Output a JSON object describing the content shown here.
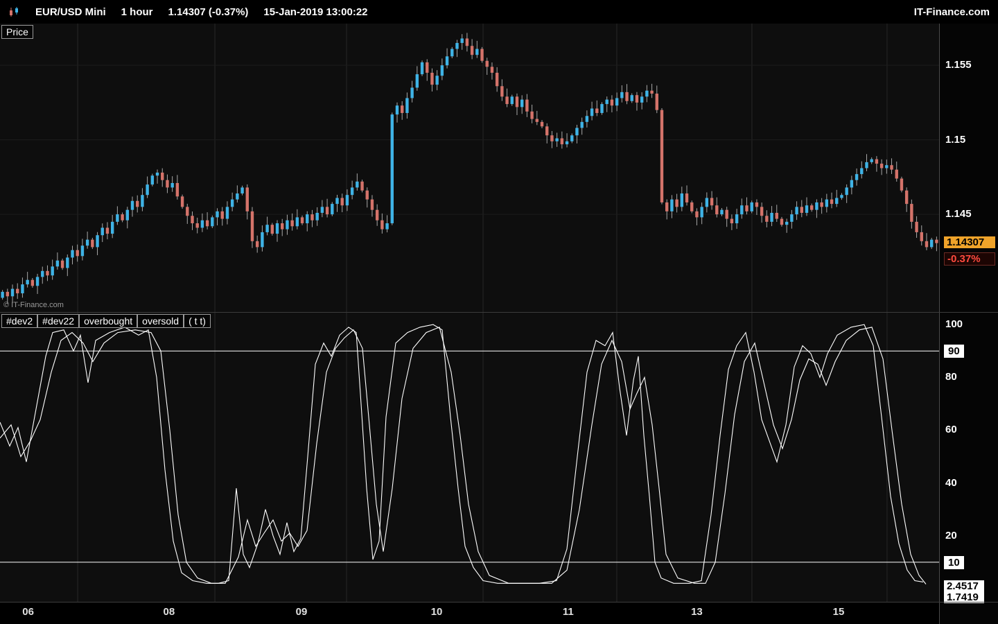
{
  "titlebar": {
    "symbol": "EUR/USD Mini",
    "timeframe": "1 hour",
    "quote": "1.14307 (-0.37%)",
    "datetime": "15-Jan-2019 13:00:22",
    "brand": "IT-Finance.com"
  },
  "watermark": "© IT-Finance.com",
  "badges": {
    "last_price": "1.14307",
    "change": "-0.37%"
  },
  "chart_data": {
    "type": "candlestick",
    "title": "EUR/USD Mini 1 hour",
    "last_price": 1.14307,
    "change_pct": -0.37,
    "colors": {
      "up": "#3fb3e6",
      "down": "#d4736a",
      "wick": "#a9a9a9",
      "line": "#ffffff",
      "grid": "#282828",
      "grid_h": "#1c1c1c",
      "badge_bg": "#f0a32a",
      "neg": "#ff4a3e"
    },
    "price_panel": {
      "label": "Price",
      "ylim": [
        1.1384,
        1.1578
      ],
      "yticks": [
        1.155,
        1.15,
        1.145
      ],
      "wick": 0.0005,
      "closes": [
        1.1398,
        1.1395,
        1.14,
        1.1397,
        1.1403,
        1.1406,
        1.1402,
        1.1408,
        1.1412,
        1.1409,
        1.1415,
        1.1419,
        1.1414,
        1.1421,
        1.1426,
        1.1422,
        1.1429,
        1.1433,
        1.1428,
        1.1436,
        1.1441,
        1.1437,
        1.1445,
        1.145,
        1.1446,
        1.1453,
        1.1459,
        1.1455,
        1.1463,
        1.147,
        1.1476,
        1.1478,
        1.1473,
        1.1468,
        1.1471,
        1.1462,
        1.1455,
        1.1449,
        1.1444,
        1.1441,
        1.1446,
        1.1442,
        1.1448,
        1.1452,
        1.1447,
        1.1455,
        1.146,
        1.1464,
        1.1468,
        1.1452,
        1.1432,
        1.1428,
        1.1438,
        1.1443,
        1.1437,
        1.1444,
        1.144,
        1.1446,
        1.1442,
        1.1448,
        1.1444,
        1.145,
        1.1446,
        1.1451,
        1.1455,
        1.145,
        1.1457,
        1.1461,
        1.1456,
        1.1463,
        1.1468,
        1.1472,
        1.1466,
        1.146,
        1.1453,
        1.1446,
        1.144,
        1.1444,
        1.1517,
        1.1523,
        1.1518,
        1.1528,
        1.1535,
        1.1544,
        1.1552,
        1.1545,
        1.1537,
        1.1543,
        1.155,
        1.1556,
        1.1561,
        1.1565,
        1.1568,
        1.1563,
        1.1557,
        1.1561,
        1.1553,
        1.1549,
        1.1545,
        1.1536,
        1.1529,
        1.1524,
        1.1529,
        1.1522,
        1.1527,
        1.1519,
        1.1514,
        1.1512,
        1.1509,
        1.1503,
        1.1499,
        1.1501,
        1.1497,
        1.1499,
        1.1503,
        1.1508,
        1.1512,
        1.1516,
        1.1521,
        1.1518,
        1.1524,
        1.1527,
        1.1523,
        1.1528,
        1.1532,
        1.1526,
        1.153,
        1.1525,
        1.1529,
        1.1533,
        1.1531,
        1.152,
        1.1458,
        1.1452,
        1.146,
        1.1455,
        1.1464,
        1.1458,
        1.1452,
        1.1448,
        1.1455,
        1.1461,
        1.1456,
        1.145,
        1.1453,
        1.1447,
        1.1444,
        1.145,
        1.1456,
        1.1452,
        1.1458,
        1.1455,
        1.1449,
        1.1445,
        1.1451,
        1.1447,
        1.1443,
        1.1445,
        1.145,
        1.1455,
        1.1451,
        1.1456,
        1.1453,
        1.1458,
        1.1455,
        1.146,
        1.1457,
        1.1461,
        1.1463,
        1.1468,
        1.1473,
        1.1477,
        1.1481,
        1.1485,
        1.1487,
        1.1484,
        1.1481,
        1.1483,
        1.148,
        1.1474,
        1.1466,
        1.1457,
        1.1445,
        1.1438,
        1.1432,
        1.1428,
        1.1433,
        1.14307
      ]
    },
    "osc_panel": {
      "legend": [
        "#dev2",
        "#dev22",
        "overbought",
        "oversold",
        "( t t)"
      ],
      "ylim": [
        -5,
        104.5
      ],
      "yticks_plain": [
        100,
        80,
        60,
        40,
        20
      ],
      "yticks_boxed": [
        90,
        10
      ],
      "levels": [
        90,
        10
      ],
      "last_values": [
        "2.4517",
        "1.7419"
      ],
      "line1": [
        [
          0,
          63
        ],
        [
          14,
          54
        ],
        [
          26,
          61
        ],
        [
          38,
          48
        ],
        [
          52,
          68
        ],
        [
          66,
          88
        ],
        [
          76,
          97
        ],
        [
          92,
          98
        ],
        [
          106,
          90
        ],
        [
          116,
          96
        ],
        [
          127,
          78
        ],
        [
          138,
          94
        ],
        [
          158,
          97
        ],
        [
          180,
          99
        ],
        [
          200,
          96
        ],
        [
          214,
          98
        ],
        [
          226,
          80
        ],
        [
          238,
          45
        ],
        [
          250,
          18
        ],
        [
          262,
          6
        ],
        [
          278,
          3
        ],
        [
          298,
          2
        ],
        [
          315,
          2
        ],
        [
          330,
          3
        ],
        [
          341,
          38
        ],
        [
          351,
          13
        ],
        [
          360,
          8
        ],
        [
          372,
          17
        ],
        [
          383,
          30
        ],
        [
          394,
          20
        ],
        [
          404,
          13
        ],
        [
          414,
          25
        ],
        [
          424,
          14
        ],
        [
          434,
          19
        ],
        [
          444,
          50
        ],
        [
          455,
          85
        ],
        [
          467,
          93
        ],
        [
          478,
          88
        ],
        [
          490,
          96
        ],
        [
          503,
          99
        ],
        [
          514,
          97
        ],
        [
          521,
          70
        ],
        [
          529,
          38
        ],
        [
          538,
          11
        ],
        [
          547,
          18
        ],
        [
          557,
          65
        ],
        [
          571,
          93
        ],
        [
          588,
          97
        ],
        [
          606,
          99
        ],
        [
          625,
          100
        ],
        [
          638,
          98
        ],
        [
          650,
          65
        ],
        [
          661,
          38
        ],
        [
          671,
          16
        ],
        [
          683,
          8
        ],
        [
          697,
          3
        ],
        [
          718,
          2
        ],
        [
          748,
          2
        ],
        [
          778,
          2
        ],
        [
          803,
          3
        ],
        [
          818,
          15
        ],
        [
          833,
          50
        ],
        [
          847,
          82
        ],
        [
          860,
          94
        ],
        [
          873,
          92
        ],
        [
          884,
          97
        ],
        [
          894,
          76
        ],
        [
          904,
          58
        ],
        [
          914,
          79
        ],
        [
          921,
          88
        ],
        [
          929,
          58
        ],
        [
          937,
          35
        ],
        [
          945,
          10
        ],
        [
          954,
          4
        ],
        [
          972,
          2
        ],
        [
          995,
          2
        ],
        [
          1012,
          3
        ],
        [
          1026,
          28
        ],
        [
          1039,
          58
        ],
        [
          1051,
          83
        ],
        [
          1063,
          92
        ],
        [
          1076,
          97
        ],
        [
          1088,
          82
        ],
        [
          1099,
          64
        ],
        [
          1110,
          56
        ],
        [
          1121,
          48
        ],
        [
          1134,
          62
        ],
        [
          1146,
          84
        ],
        [
          1158,
          92
        ],
        [
          1170,
          89
        ],
        [
          1183,
          80
        ],
        [
          1194,
          89
        ],
        [
          1208,
          96
        ],
        [
          1228,
          99
        ],
        [
          1247,
          100
        ],
        [
          1260,
          92
        ],
        [
          1272,
          65
        ],
        [
          1285,
          35
        ],
        [
          1297,
          17
        ],
        [
          1309,
          7
        ],
        [
          1320,
          3
        ],
        [
          1332,
          2.5
        ]
      ],
      "line2": [
        [
          0,
          57
        ],
        [
          16,
          62
        ],
        [
          30,
          50
        ],
        [
          44,
          56
        ],
        [
          58,
          64
        ],
        [
          74,
          82
        ],
        [
          88,
          94
        ],
        [
          104,
          97
        ],
        [
          120,
          93
        ],
        [
          134,
          86
        ],
        [
          150,
          93
        ],
        [
          170,
          97
        ],
        [
          195,
          98
        ],
        [
          218,
          97
        ],
        [
          232,
          90
        ],
        [
          245,
          60
        ],
        [
          257,
          28
        ],
        [
          269,
          10
        ],
        [
          285,
          4
        ],
        [
          305,
          2
        ],
        [
          325,
          2
        ],
        [
          344,
          12
        ],
        [
          357,
          26
        ],
        [
          369,
          16
        ],
        [
          381,
          21
        ],
        [
          394,
          26
        ],
        [
          406,
          18
        ],
        [
          418,
          21
        ],
        [
          430,
          16
        ],
        [
          443,
          22
        ],
        [
          457,
          55
        ],
        [
          471,
          82
        ],
        [
          484,
          91
        ],
        [
          497,
          95
        ],
        [
          510,
          98
        ],
        [
          523,
          91
        ],
        [
          533,
          62
        ],
        [
          543,
          32
        ],
        [
          553,
          14
        ],
        [
          566,
          38
        ],
        [
          580,
          72
        ],
        [
          596,
          91
        ],
        [
          615,
          97
        ],
        [
          634,
          99
        ],
        [
          651,
          82
        ],
        [
          664,
          58
        ],
        [
          676,
          32
        ],
        [
          690,
          14
        ],
        [
          706,
          5
        ],
        [
          734,
          2
        ],
        [
          764,
          2
        ],
        [
          796,
          2
        ],
        [
          818,
          7
        ],
        [
          836,
          30
        ],
        [
          854,
          62
        ],
        [
          868,
          85
        ],
        [
          883,
          94
        ],
        [
          897,
          86
        ],
        [
          909,
          68
        ],
        [
          919,
          74
        ],
        [
          930,
          80
        ],
        [
          941,
          62
        ],
        [
          951,
          38
        ],
        [
          961,
          13
        ],
        [
          978,
          4
        ],
        [
          1002,
          2
        ],
        [
          1018,
          2
        ],
        [
          1032,
          10
        ],
        [
          1046,
          36
        ],
        [
          1060,
          66
        ],
        [
          1074,
          86
        ],
        [
          1089,
          93
        ],
        [
          1103,
          77
        ],
        [
          1116,
          62
        ],
        [
          1129,
          53
        ],
        [
          1142,
          64
        ],
        [
          1154,
          79
        ],
        [
          1167,
          87
        ],
        [
          1180,
          85
        ],
        [
          1192,
          77
        ],
        [
          1205,
          86
        ],
        [
          1221,
          94
        ],
        [
          1240,
          98
        ],
        [
          1258,
          99
        ],
        [
          1274,
          87
        ],
        [
          1288,
          58
        ],
        [
          1301,
          32
        ],
        [
          1314,
          13
        ],
        [
          1326,
          5
        ],
        [
          1336,
          1.7
        ]
      ]
    },
    "x_axis": {
      "labels": [
        {
          "t": "06",
          "x": 0.03
        },
        {
          "t": "08",
          "x": 0.18
        },
        {
          "t": "09",
          "x": 0.321
        },
        {
          "t": "10",
          "x": 0.465
        },
        {
          "t": "11",
          "x": 0.605
        },
        {
          "t": "13",
          "x": 0.742
        },
        {
          "t": "15",
          "x": 0.893
        }
      ]
    },
    "day_boundaries": [
      0.0827,
      0.2288,
      0.369,
      0.5144,
      0.6568,
      0.8007,
      0.9446
    ]
  }
}
